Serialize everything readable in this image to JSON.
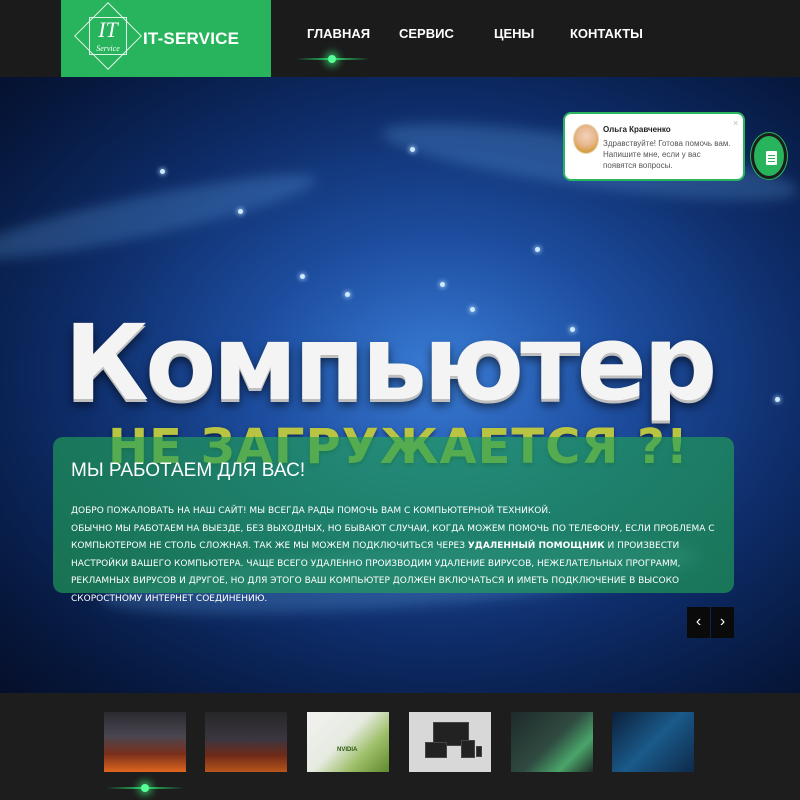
{
  "header": {
    "logo": {
      "mark": "IT",
      "sub": "Service",
      "title": "IT-SERVICE"
    },
    "nav": [
      {
        "label": "ГЛАВНАЯ"
      },
      {
        "label": "СЕРВИС"
      },
      {
        "label": "ЦЕНЫ"
      },
      {
        "label": "КОНТАКТЫ"
      }
    ],
    "active_nav_index": 0,
    "accent_color": "#27b45c"
  },
  "hero": {
    "image_title": "Компьютер",
    "image_subtitle": "НЕ ЗАГРУЖАЕТСЯ ?!",
    "caption": {
      "title": "МЫ РАБОТАЕМ ДЛЯ ВАС!",
      "line1": "ДОБРО ПОЖАЛОВАТЬ НА НАШ САЙТ! МЫ ВСЕГДА РАДЫ ПОМОЧЬ ВАМ С КОМПЬЮТЕРНОЙ ТЕХНИКОЙ.",
      "line2": "ОБЫЧНО МЫ РАБОТАЕМ НА ВЫЕЗДЕ, БЕЗ ВЫХОДНЫХ, НО БЫВАЮТ СЛУЧАИ, КОГДА МОЖЕМ ПОМОЧЬ ПО ТЕЛЕФОНУ, ЕСЛИ ПРОБЛЕМА С КОМПЬЮТЕРОМ НЕ СТОЛЬ СЛОЖНАЯ. ТАК ЖЕ МЫ МОЖЕМ ПОДКЛЮЧИТЬСЯ ЧЕРЕЗ",
      "bold": "УДАЛЕННЫЙ ПОМОЩНИК",
      "line3": "И ПРОИЗВЕСТИ НАСТРОЙКИ ВАШЕГО КОМПЬЮТЕРА. ЧАЩЕ ВСЕГО УДАЛЕННО ПРОИЗВОДИМ УДАЛЕНИЕ ВИРУСОВ, НЕЖЕЛАТЕЛЬНЫХ ПРОГРАММ, РЕКЛАМНЫХ ВИРУСОВ И ДРУГОЕ, НО ДЛЯ ЭТОГО ВАШ КОМПЬЮТЕР ДОЛЖЕН ВКЛЮЧАТЬСЯ И ИМЕТЬ ПОДКЛЮЧЕНИЕ В ВЫСОКО СКОРОСТНОМУ ИНТЕРНЕТ СОЕДИНЕНИЮ."
    },
    "prev_label": "‹",
    "next_label": "›"
  },
  "chat": {
    "name": "Ольга Кравченко",
    "message": "Здравствуйте! Готова помочь вам. Напишите мне, если у вас появятся вопросы.",
    "close_label": "×",
    "button_icon": "document-icon"
  },
  "thumbnails": {
    "count": 6,
    "active_index": 0,
    "t3_text": "NVIDIA"
  }
}
